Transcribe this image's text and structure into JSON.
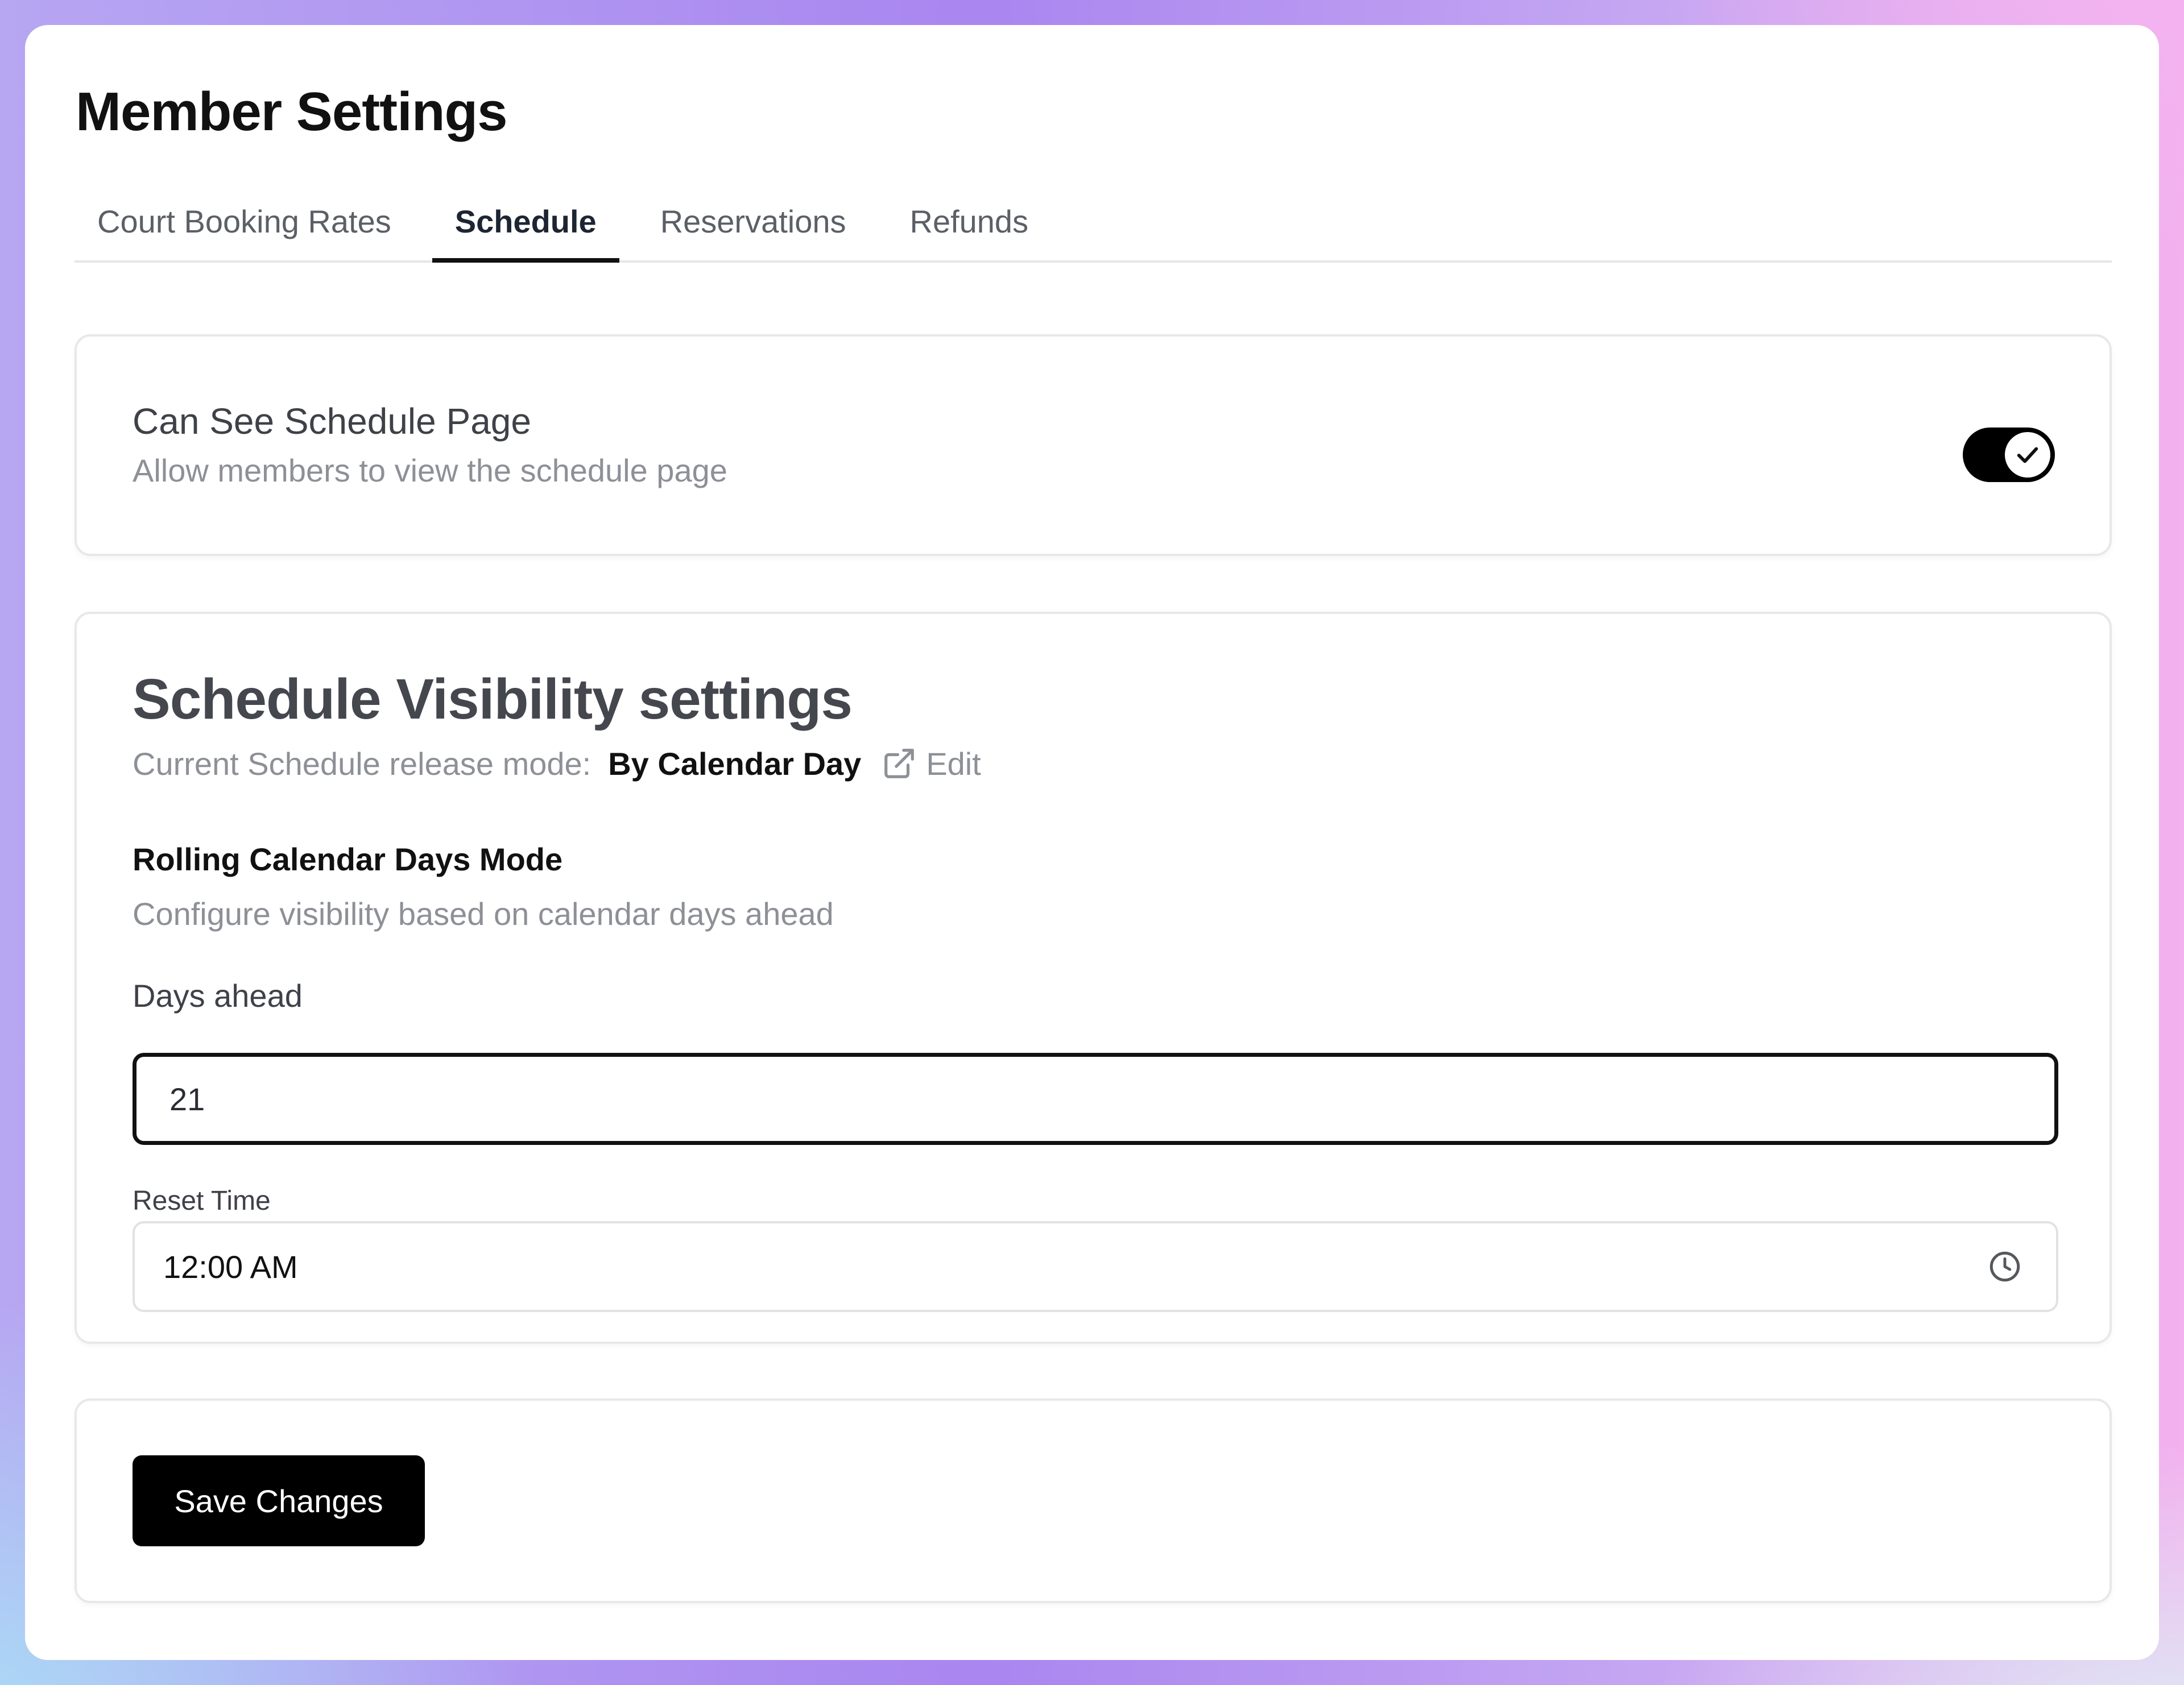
{
  "page": {
    "title": "Member Settings"
  },
  "tabs": [
    {
      "label": "Court Booking Rates",
      "active": false
    },
    {
      "label": "Schedule",
      "active": true
    },
    {
      "label": "Reservations",
      "active": false
    },
    {
      "label": "Refunds",
      "active": false
    }
  ],
  "schedule_page": {
    "title": "Can See Schedule Page",
    "description": "Allow members to view the schedule page",
    "toggle_on": true,
    "toggle_icon": "check-icon"
  },
  "visibility": {
    "title": "Schedule Visibility settings",
    "mode_label": "Current Schedule release mode:",
    "mode_value": "By Calendar Day",
    "edit_label": "Edit",
    "edit_icon": "external-link-icon",
    "section_title": "Rolling Calendar Days Mode",
    "section_description": "Configure visibility based on calendar days ahead",
    "days_ahead_label": "Days ahead",
    "days_ahead_value": "21",
    "reset_time_label": "Reset Time",
    "reset_time_value": "12:00 AM",
    "reset_time_icon": "clock-icon"
  },
  "actions": {
    "save_label": "Save Changes"
  },
  "colors": {
    "accent": "#000000",
    "muted_text": "#8d9096",
    "border": "#e8e8e8"
  }
}
